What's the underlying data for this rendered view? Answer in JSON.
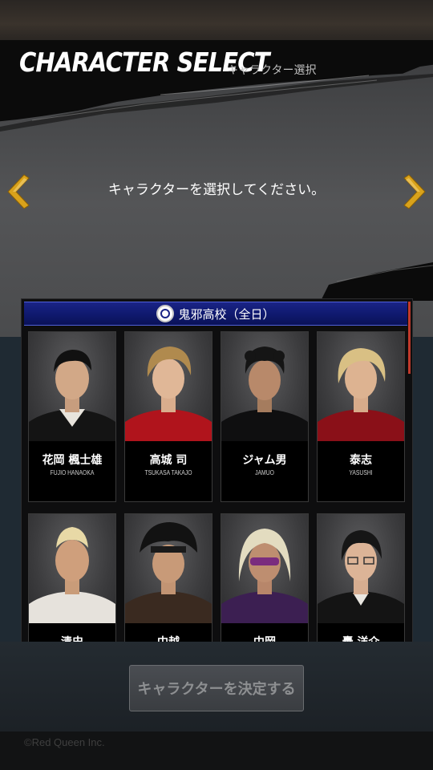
{
  "header": {
    "title_en": "CHARACTER SELECT",
    "title_jp": "キャラクター選択"
  },
  "instruction": "キャラクターを選択してください。",
  "nav": {
    "prev_icon": "chevron-left-icon",
    "next_icon": "chevron-right-icon",
    "accent_color": "#d9a21b"
  },
  "school": {
    "name": "鬼邪高校（全日）",
    "header_color": "#1a2486"
  },
  "characters": [
    {
      "name_jp": "花岡 楓士雄",
      "name_en": "FUJIO HANAOKA"
    },
    {
      "name_jp": "高城 司",
      "name_en": "TSUKASA TAKAJO"
    },
    {
      "name_jp": "ジャム男",
      "name_en": "JAMUO"
    },
    {
      "name_jp": "泰志",
      "name_en": "YASUSHI"
    },
    {
      "name_jp": "清史",
      "name_en": ""
    },
    {
      "name_jp": "中越",
      "name_en": ""
    },
    {
      "name_jp": "中岡",
      "name_en": ""
    },
    {
      "name_jp": "轟 洋介",
      "name_en": ""
    }
  ],
  "confirm_button": "キャラクターを決定する",
  "copyright": "©Red Queen Inc."
}
